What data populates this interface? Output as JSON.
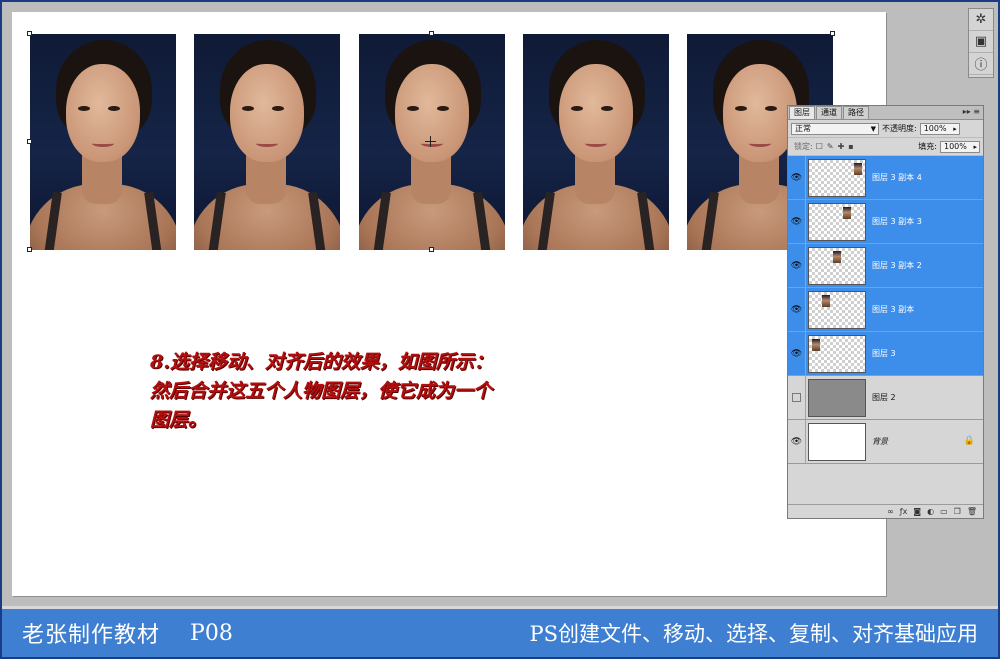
{
  "instruction": {
    "line1": "8.选择移动、对齐后的效果，如图所示：",
    "line2": "然后合并这五个人物图层，使它成为一个",
    "line3": "图层。"
  },
  "layers_panel": {
    "tabs": [
      "图层",
      "通道",
      "路径"
    ],
    "active_tab": "图层",
    "blend_mode": "正常",
    "opacity_label": "不透明度:",
    "opacity_value": "100%",
    "lock_label": "锁定:",
    "fill_label": "填充:",
    "fill_value": "100%",
    "layers": [
      {
        "name": "图层 3 副本 4",
        "active": true,
        "visible": true,
        "thumb": "transparent"
      },
      {
        "name": "图层 3 副本 3",
        "active": true,
        "visible": true,
        "thumb": "transparent"
      },
      {
        "name": "图层 3 副本 2",
        "active": true,
        "visible": true,
        "thumb": "transparent"
      },
      {
        "name": "图层 3 副本",
        "active": true,
        "visible": true,
        "thumb": "transparent"
      },
      {
        "name": "图层 3",
        "active": true,
        "visible": true,
        "thumb": "transparent"
      },
      {
        "name": "图层 2",
        "active": false,
        "visible": false,
        "thumb": "gray"
      },
      {
        "name": "背景",
        "active": false,
        "visible": true,
        "thumb": "white",
        "locked": true
      }
    ]
  },
  "banner": {
    "left": "老张制作教材",
    "page": "P08",
    "right": "PS创建文件、移动、选择、复制、对齐基础应用"
  },
  "colors": {
    "banner_bg": "#3f7fd2",
    "layer_selected": "#3d8eea",
    "instruction_text": "#b40f0f"
  },
  "icons": {
    "dock": [
      "brush-settings-icon",
      "image-icon",
      "info-icon"
    ],
    "eye": "eye-icon",
    "lock": "lock-icon"
  }
}
